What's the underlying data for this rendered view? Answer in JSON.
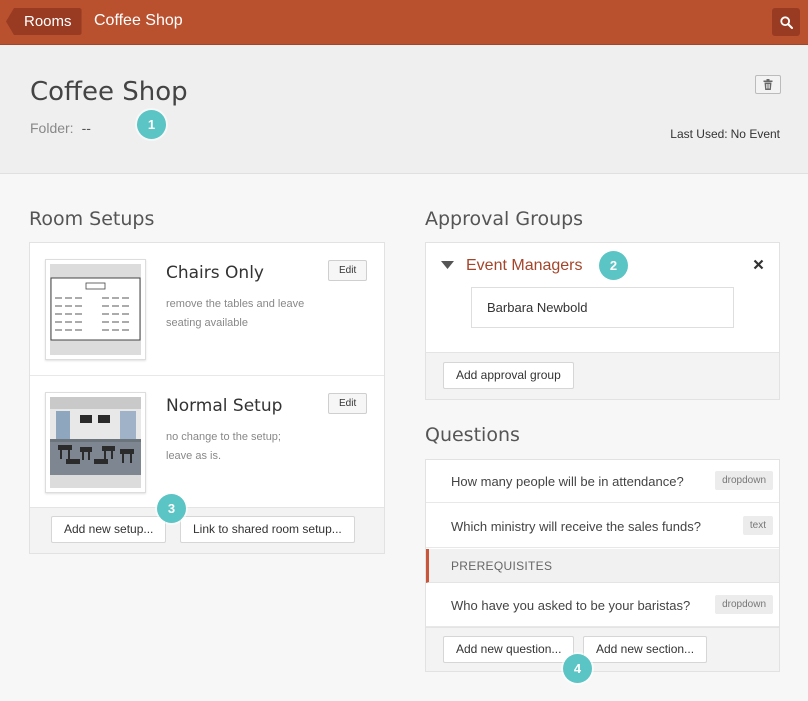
{
  "topbar": {
    "breadcrumb": "Rooms",
    "title": "Coffee Shop",
    "search_icon": "search-icon"
  },
  "header": {
    "title": "Coffee Shop",
    "folder_label": "Folder:",
    "folder_value": "--",
    "last_used_label": "Last Used:",
    "last_used_value": "No Event",
    "trash_icon": "trash-icon"
  },
  "badges": [
    "1",
    "2",
    "3",
    "4"
  ],
  "room_setups": {
    "heading": "Room Setups",
    "items": [
      {
        "name": "Chairs Only",
        "description": "remove the tables and leave seating available",
        "edit_label": "Edit",
        "thumbnail": "floor-plan-diagram"
      },
      {
        "name": "Normal Setup",
        "description": "no change to the setup; leave as is.",
        "edit_label": "Edit",
        "thumbnail": "room-photo"
      }
    ],
    "add_button": "Add new setup...",
    "link_button": "Link to shared room setup..."
  },
  "approval_groups": {
    "heading": "Approval Groups",
    "groups": [
      {
        "name": "Event Managers",
        "members": [
          "Barbara Newbold"
        ]
      }
    ],
    "add_button": "Add approval group"
  },
  "questions": {
    "heading": "Questions",
    "items": [
      {
        "kind": "question",
        "text": "How many people will be in attendance?",
        "type": "dropdown"
      },
      {
        "kind": "question",
        "text": "Which ministry will receive the sales funds?",
        "type": "text"
      },
      {
        "kind": "section",
        "text": "PREREQUISITES"
      },
      {
        "kind": "question",
        "text": "Who have you asked to be your baristas?",
        "type": "dropdown"
      }
    ],
    "add_question_button": "Add new question...",
    "add_section_button": "Add new section..."
  },
  "colors": {
    "topbar": "#b9512f",
    "accent": "#a4452a",
    "badge": "#5bc4c4"
  }
}
